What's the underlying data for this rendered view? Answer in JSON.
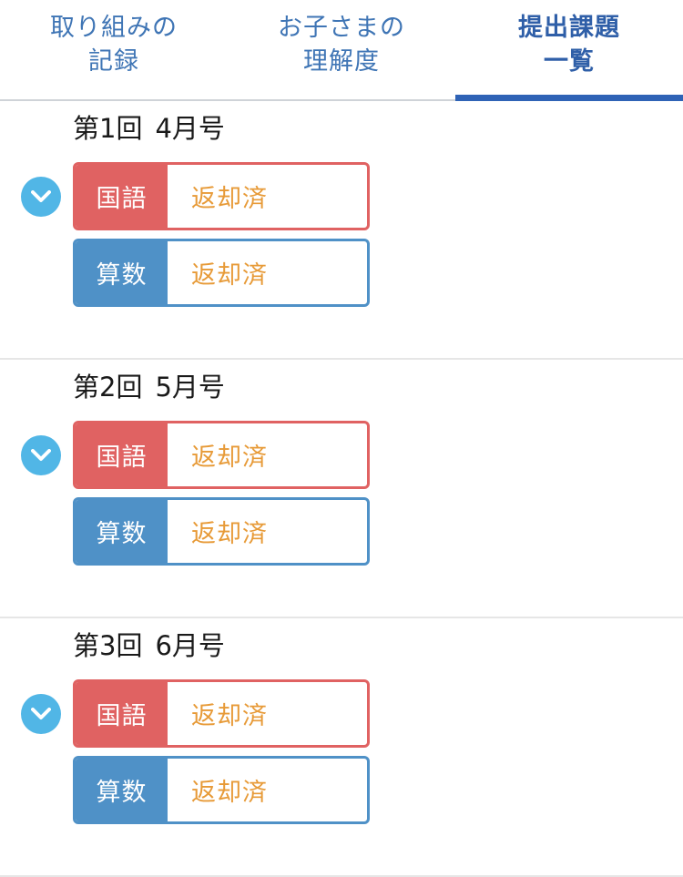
{
  "tabs": [
    {
      "lines": [
        "取り組みの",
        "記録"
      ],
      "active": false
    },
    {
      "lines": [
        "お子さまの",
        "理解度"
      ],
      "active": false
    },
    {
      "lines": [
        "提出課題",
        "一覧"
      ],
      "active": true
    }
  ],
  "colors": {
    "tab_text": "#3f75b5",
    "tab_active_text": "#2f5fa8",
    "tab_indicator": "#2f63b6",
    "toggle_icon_bg": "#51b6e6",
    "subject_japanese": "#e06262",
    "subject_math": "#4f91c7",
    "status_text": "#e79a37",
    "divider": "#e6e6e6"
  },
  "icons": {
    "toggle": "chevron-down-circle-icon"
  },
  "issues": [
    {
      "number_label": "第1回",
      "month_label": "4月号",
      "subjects": [
        {
          "name": "国語",
          "status": "返却済",
          "color_key": "subject_japanese"
        },
        {
          "name": "算数",
          "status": "返却済",
          "color_key": "subject_math"
        }
      ]
    },
    {
      "number_label": "第2回",
      "month_label": "5月号",
      "subjects": [
        {
          "name": "国語",
          "status": "返却済",
          "color_key": "subject_japanese"
        },
        {
          "name": "算数",
          "status": "返却済",
          "color_key": "subject_math"
        }
      ]
    },
    {
      "number_label": "第3回",
      "month_label": "6月号",
      "subjects": [
        {
          "name": "国語",
          "status": "返却済",
          "color_key": "subject_japanese"
        },
        {
          "name": "算数",
          "status": "返却済",
          "color_key": "subject_math"
        }
      ]
    }
  ]
}
